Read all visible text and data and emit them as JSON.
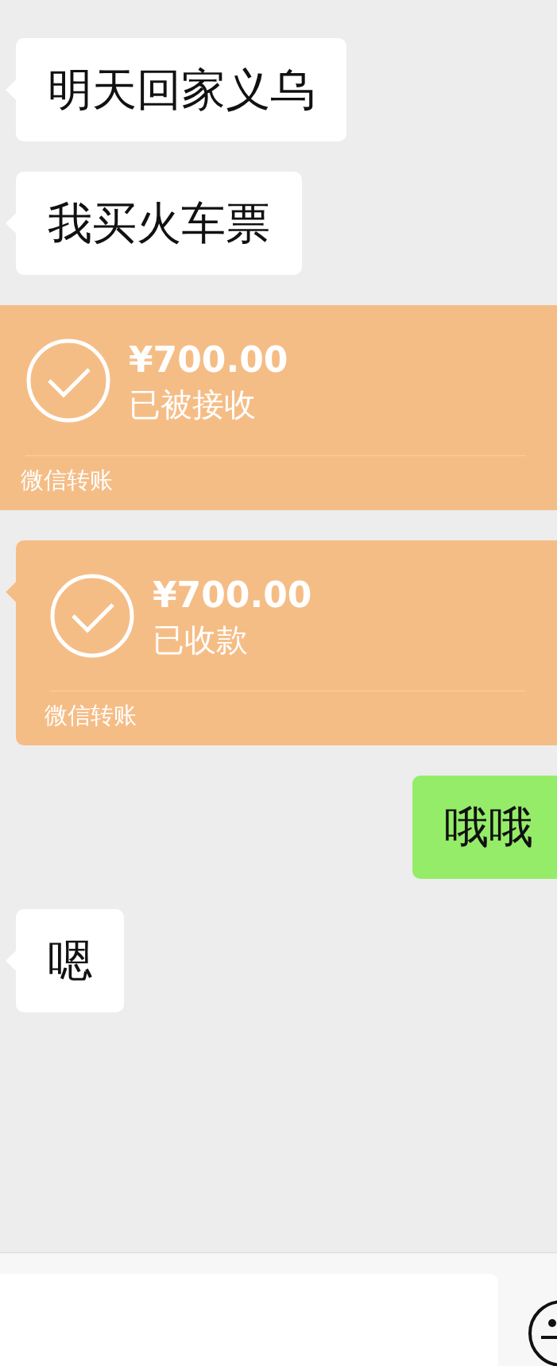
{
  "messages": [
    {
      "kind": "received",
      "text": "明天回家义乌"
    },
    {
      "kind": "received",
      "text": "我买火车票"
    },
    {
      "kind": "transfer",
      "tail": false,
      "amount": "¥700.00",
      "status": "已被接收",
      "footer": "微信转账"
    },
    {
      "kind": "transfer",
      "tail": true,
      "amount": "¥700.00",
      "status": "已收款",
      "footer": "微信转账"
    },
    {
      "kind": "sent",
      "text": "哦哦"
    },
    {
      "kind": "received",
      "text": "嗯"
    }
  ]
}
